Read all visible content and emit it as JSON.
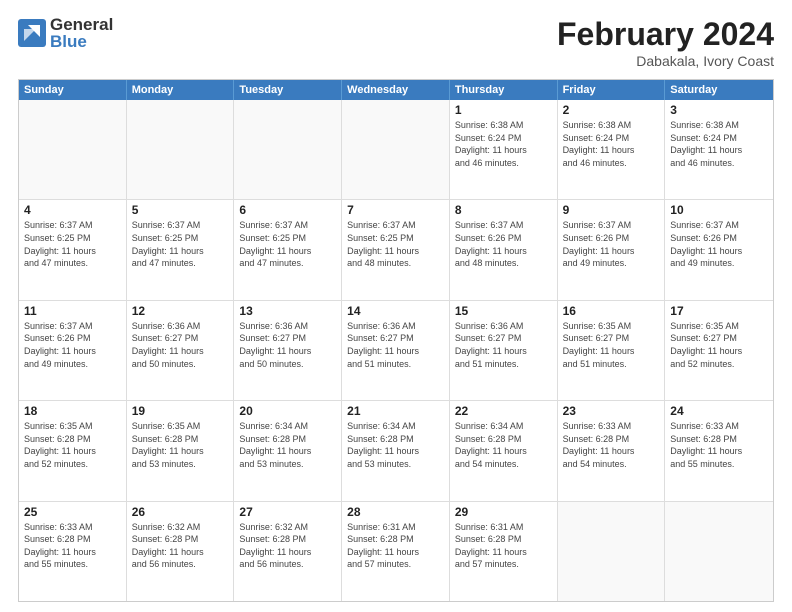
{
  "logo": {
    "general": "General",
    "blue": "Blue"
  },
  "title": "February 2024",
  "location": "Dabakala, Ivory Coast",
  "header_days": [
    "Sunday",
    "Monday",
    "Tuesday",
    "Wednesday",
    "Thursday",
    "Friday",
    "Saturday"
  ],
  "rows": [
    [
      {
        "day": "",
        "info": ""
      },
      {
        "day": "",
        "info": ""
      },
      {
        "day": "",
        "info": ""
      },
      {
        "day": "",
        "info": ""
      },
      {
        "day": "1",
        "info": "Sunrise: 6:38 AM\nSunset: 6:24 PM\nDaylight: 11 hours\nand 46 minutes."
      },
      {
        "day": "2",
        "info": "Sunrise: 6:38 AM\nSunset: 6:24 PM\nDaylight: 11 hours\nand 46 minutes."
      },
      {
        "day": "3",
        "info": "Sunrise: 6:38 AM\nSunset: 6:24 PM\nDaylight: 11 hours\nand 46 minutes."
      }
    ],
    [
      {
        "day": "4",
        "info": "Sunrise: 6:37 AM\nSunset: 6:25 PM\nDaylight: 11 hours\nand 47 minutes."
      },
      {
        "day": "5",
        "info": "Sunrise: 6:37 AM\nSunset: 6:25 PM\nDaylight: 11 hours\nand 47 minutes."
      },
      {
        "day": "6",
        "info": "Sunrise: 6:37 AM\nSunset: 6:25 PM\nDaylight: 11 hours\nand 47 minutes."
      },
      {
        "day": "7",
        "info": "Sunrise: 6:37 AM\nSunset: 6:25 PM\nDaylight: 11 hours\nand 48 minutes."
      },
      {
        "day": "8",
        "info": "Sunrise: 6:37 AM\nSunset: 6:26 PM\nDaylight: 11 hours\nand 48 minutes."
      },
      {
        "day": "9",
        "info": "Sunrise: 6:37 AM\nSunset: 6:26 PM\nDaylight: 11 hours\nand 49 minutes."
      },
      {
        "day": "10",
        "info": "Sunrise: 6:37 AM\nSunset: 6:26 PM\nDaylight: 11 hours\nand 49 minutes."
      }
    ],
    [
      {
        "day": "11",
        "info": "Sunrise: 6:37 AM\nSunset: 6:26 PM\nDaylight: 11 hours\nand 49 minutes."
      },
      {
        "day": "12",
        "info": "Sunrise: 6:36 AM\nSunset: 6:27 PM\nDaylight: 11 hours\nand 50 minutes."
      },
      {
        "day": "13",
        "info": "Sunrise: 6:36 AM\nSunset: 6:27 PM\nDaylight: 11 hours\nand 50 minutes."
      },
      {
        "day": "14",
        "info": "Sunrise: 6:36 AM\nSunset: 6:27 PM\nDaylight: 11 hours\nand 51 minutes."
      },
      {
        "day": "15",
        "info": "Sunrise: 6:36 AM\nSunset: 6:27 PM\nDaylight: 11 hours\nand 51 minutes."
      },
      {
        "day": "16",
        "info": "Sunrise: 6:35 AM\nSunset: 6:27 PM\nDaylight: 11 hours\nand 51 minutes."
      },
      {
        "day": "17",
        "info": "Sunrise: 6:35 AM\nSunset: 6:27 PM\nDaylight: 11 hours\nand 52 minutes."
      }
    ],
    [
      {
        "day": "18",
        "info": "Sunrise: 6:35 AM\nSunset: 6:28 PM\nDaylight: 11 hours\nand 52 minutes."
      },
      {
        "day": "19",
        "info": "Sunrise: 6:35 AM\nSunset: 6:28 PM\nDaylight: 11 hours\nand 53 minutes."
      },
      {
        "day": "20",
        "info": "Sunrise: 6:34 AM\nSunset: 6:28 PM\nDaylight: 11 hours\nand 53 minutes."
      },
      {
        "day": "21",
        "info": "Sunrise: 6:34 AM\nSunset: 6:28 PM\nDaylight: 11 hours\nand 53 minutes."
      },
      {
        "day": "22",
        "info": "Sunrise: 6:34 AM\nSunset: 6:28 PM\nDaylight: 11 hours\nand 54 minutes."
      },
      {
        "day": "23",
        "info": "Sunrise: 6:33 AM\nSunset: 6:28 PM\nDaylight: 11 hours\nand 54 minutes."
      },
      {
        "day": "24",
        "info": "Sunrise: 6:33 AM\nSunset: 6:28 PM\nDaylight: 11 hours\nand 55 minutes."
      }
    ],
    [
      {
        "day": "25",
        "info": "Sunrise: 6:33 AM\nSunset: 6:28 PM\nDaylight: 11 hours\nand 55 minutes."
      },
      {
        "day": "26",
        "info": "Sunrise: 6:32 AM\nSunset: 6:28 PM\nDaylight: 11 hours\nand 56 minutes."
      },
      {
        "day": "27",
        "info": "Sunrise: 6:32 AM\nSunset: 6:28 PM\nDaylight: 11 hours\nand 56 minutes."
      },
      {
        "day": "28",
        "info": "Sunrise: 6:31 AM\nSunset: 6:28 PM\nDaylight: 11 hours\nand 57 minutes."
      },
      {
        "day": "29",
        "info": "Sunrise: 6:31 AM\nSunset: 6:28 PM\nDaylight: 11 hours\nand 57 minutes."
      },
      {
        "day": "",
        "info": ""
      },
      {
        "day": "",
        "info": ""
      }
    ]
  ]
}
